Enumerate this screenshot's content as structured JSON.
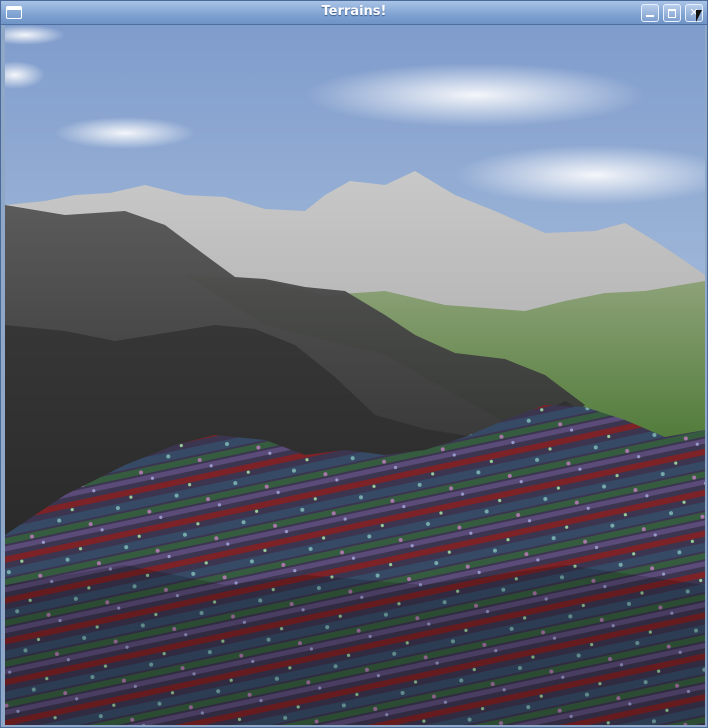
{
  "window": {
    "title": "Terrains!",
    "controls": {
      "minimize_icon": "minimize-icon",
      "maximize_icon": "maximize-icon",
      "close_icon": "close-icon"
    }
  },
  "scene": {
    "sky_color": "#9eb6d8",
    "cloud_color": "#eef2f7",
    "far_mountain_color": "#a9a9a9",
    "grass_color": "#6b8f4f",
    "shadow_mountain_color": "#2f2f2f",
    "striped_terrain_colors": [
      "#5c1f23",
      "#3a4a6a",
      "#2f5a3b",
      "#8c2a2e",
      "#5a4d7a"
    ]
  }
}
